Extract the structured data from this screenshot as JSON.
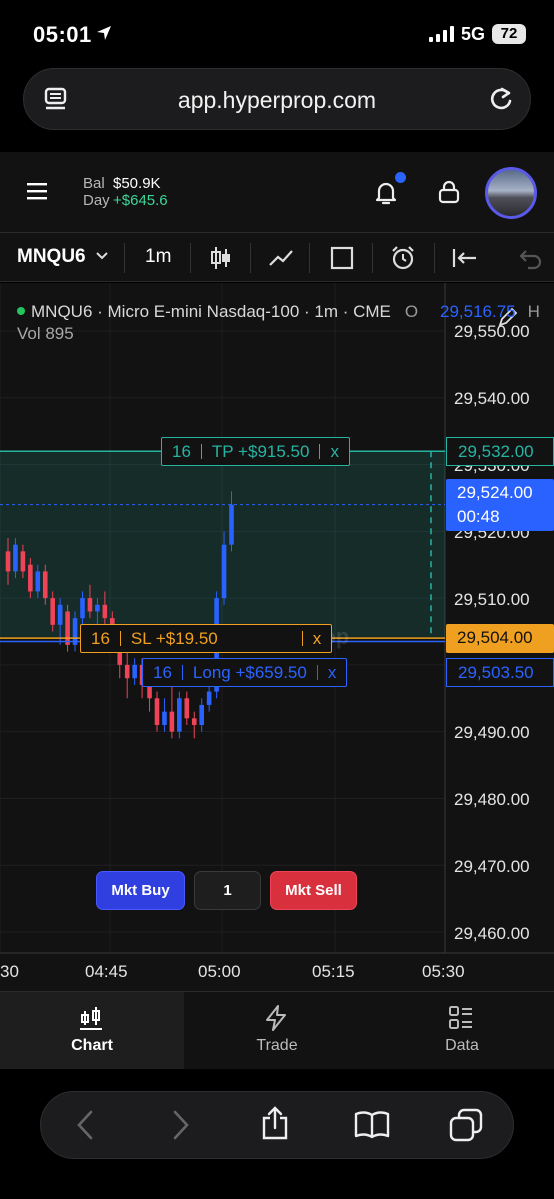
{
  "status_bar": {
    "time": "05:01",
    "network": "5G",
    "battery": "72"
  },
  "browser": {
    "url": "app.hyperprop.com"
  },
  "header": {
    "bal_label": "Bal",
    "bal_value": "$50.9K",
    "day_label": "Day",
    "day_value": "+$645.6"
  },
  "toolbar": {
    "symbol": "MNQU6",
    "timeframe": "1m"
  },
  "chart_legend": {
    "title": "MNQU6 · Micro E-mini Nasdaq-100 · 1m · CME",
    "o_label": "O",
    "o_value": "29,516.75",
    "h_label": "H",
    "volume": "Vol 895"
  },
  "watermark": "Hyperprop",
  "price_axis": [
    "29,550.00",
    "29,540.00",
    "29,520.00",
    "29,510.00",
    "29,490.00",
    "29,480.00",
    "29,470.00",
    "29,460.00"
  ],
  "price_axis_hidden": "29,530.00",
  "time_axis": [
    "30",
    "04:45",
    "05:00",
    "05:15",
    "05:30"
  ],
  "tp_line": {
    "qty": "16",
    "label": "TP +$915.50",
    "close": "x",
    "price": "29,532.00"
  },
  "sl_line": {
    "qty": "16",
    "label": "SL +$19.50",
    "close": "x",
    "price": "29,504.00"
  },
  "long_line": {
    "qty": "16",
    "label": "Long +$659.50",
    "close": "x",
    "price": "29,503.50"
  },
  "last_price": {
    "price": "29,524.00",
    "countdown": "00:48"
  },
  "order_panel": {
    "buy_label": "Mkt Buy",
    "qty": "1",
    "sell_label": "Mkt Sell"
  },
  "bottom_nav": [
    {
      "label": "Chart",
      "active": true
    },
    {
      "label": "Trade",
      "active": false
    },
    {
      "label": "Data",
      "active": false
    }
  ],
  "chart_data": {
    "type": "candlestick",
    "x_ticks": [
      "30",
      "04:45",
      "05:00",
      "05:15",
      "05:30"
    ],
    "y_ticks": [
      29460,
      29470,
      29480,
      29490,
      29500,
      29510,
      29520,
      29530,
      29540,
      29550
    ],
    "ylim": [
      29458,
      29552
    ],
    "candles": [
      {
        "o": 29517,
        "c": 29514,
        "h": 29519,
        "l": 29512
      },
      {
        "o": 29514,
        "c": 29518,
        "h": 29519,
        "l": 29513
      },
      {
        "o": 29517,
        "c": 29514,
        "h": 29518,
        "l": 29513
      },
      {
        "o": 29515,
        "c": 29511,
        "h": 29516,
        "l": 29510
      },
      {
        "o": 29511,
        "c": 29514,
        "h": 29515,
        "l": 29510
      },
      {
        "o": 29514,
        "c": 29510,
        "h": 29515,
        "l": 29509
      },
      {
        "o": 29510,
        "c": 29506,
        "h": 29511,
        "l": 29505
      },
      {
        "o": 29506,
        "c": 29509,
        "h": 29510,
        "l": 29503
      },
      {
        "o": 29508,
        "c": 29503,
        "h": 29509,
        "l": 29502
      },
      {
        "o": 29503,
        "c": 29507,
        "h": 29508,
        "l": 29502
      },
      {
        "o": 29507,
        "c": 29510,
        "h": 29511,
        "l": 29506
      },
      {
        "o": 29510,
        "c": 29508,
        "h": 29512,
        "l": 29507
      },
      {
        "o": 29508,
        "c": 29509,
        "h": 29510,
        "l": 29506
      },
      {
        "o": 29509,
        "c": 29507,
        "h": 29511,
        "l": 29503
      },
      {
        "o": 29507,
        "c": 29503,
        "h": 29508,
        "l": 29502
      },
      {
        "o": 29503,
        "c": 29500,
        "h": 29504,
        "l": 29498
      },
      {
        "o": 29500,
        "c": 29498,
        "h": 29502,
        "l": 29495
      },
      {
        "o": 29498,
        "c": 29500,
        "h": 29501,
        "l": 29497
      },
      {
        "o": 29500,
        "c": 29497,
        "h": 29501,
        "l": 29495
      },
      {
        "o": 29497,
        "c": 29495,
        "h": 29498,
        "l": 29493
      },
      {
        "o": 29495,
        "c": 29491,
        "h": 29496,
        "l": 29490
      },
      {
        "o": 29491,
        "c": 29493,
        "h": 29495,
        "l": 29490
      },
      {
        "o": 29493,
        "c": 29490,
        "h": 29497,
        "l": 29489
      },
      {
        "o": 29490,
        "c": 29495,
        "h": 29496,
        "l": 29489
      },
      {
        "o": 29495,
        "c": 29492,
        "h": 29496,
        "l": 29491
      },
      {
        "o": 29492,
        "c": 29491,
        "h": 29493,
        "l": 29489
      },
      {
        "o": 29491,
        "c": 29494,
        "h": 29495,
        "l": 29490
      },
      {
        "o": 29494,
        "c": 29496,
        "h": 29497,
        "l": 29493
      },
      {
        "o": 29496,
        "c": 29510,
        "h": 29511,
        "l": 29495
      },
      {
        "o": 29510,
        "c": 29518,
        "h": 29520,
        "l": 29509
      },
      {
        "o": 29518,
        "c": 29524,
        "h": 29526,
        "l": 29517
      }
    ],
    "levels": {
      "tp": 29532,
      "last": 29524,
      "sl": 29504,
      "entry": 29503.5
    },
    "colors": {
      "up": "#2962ff",
      "down": "#ef4458",
      "tp": "#26b4a2",
      "sl": "#f0a020",
      "entry": "#2b63ff"
    }
  }
}
